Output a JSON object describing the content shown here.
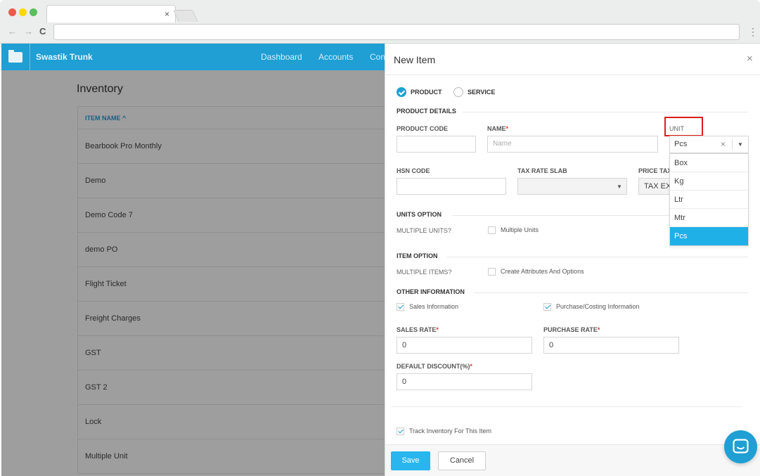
{
  "browser": {
    "tab_close_glyph": "×",
    "back_glyph": "←",
    "forward_glyph": "→",
    "reload_glyph": "C",
    "menu_glyph": "⋮"
  },
  "app": {
    "brand": "Swastik Trunk",
    "nav": [
      "Dashboard",
      "Accounts",
      "Con"
    ]
  },
  "inventory": {
    "title": "Inventory",
    "column_header": "ITEM NAME ^",
    "rows": [
      "Bearbook Pro Monthly",
      "Demo",
      "Demo Code 7",
      "demo PO",
      "Flight Ticket",
      "Freight Charges",
      "GST",
      "GST 2",
      "Lock",
      "Multiple Unit"
    ]
  },
  "panel": {
    "title": "New Item",
    "close_glyph": "×",
    "type_options": [
      {
        "label": "PRODUCT",
        "selected": true
      },
      {
        "label": "SERVICE",
        "selected": false
      }
    ],
    "product_details": {
      "heading": "PRODUCT DETAILS",
      "product_code_label": "PRODUCT CODE",
      "product_code_value": "",
      "name_label": "NAME",
      "name_required": "*",
      "name_placeholder": "Name",
      "unit_label": "UNIT",
      "unit_value": "Pcs",
      "unit_clear_glyph": "×",
      "unit_options": [
        "Box",
        "Kg",
        "Ltr",
        "Mtr",
        "Pcs"
      ],
      "unit_selected": "Pcs",
      "hsn_label": "HSN CODE",
      "hsn_value": "",
      "tax_slab_label": "TAX RATE SLAB",
      "tax_slab_value": "",
      "price_tax_label": "PRICE TAX",
      "price_tax_value": "TAX EX"
    },
    "units_option": {
      "heading": "UNITS OPTION",
      "label": "MULTIPLE UNITS?",
      "checkbox_label": "Multiple Units",
      "checked": false
    },
    "item_option": {
      "heading": "ITEM OPTION",
      "label": "MULTIPLE ITEMS?",
      "checkbox_label": "Create Attributes And Options",
      "checked": false
    },
    "other_information": {
      "heading": "OTHER INFORMATION",
      "sales_info_label": "Sales Information",
      "sales_info_checked": true,
      "purchase_info_label": "Purchase/Costing Information",
      "purchase_info_checked": true,
      "sales_rate_label": "SALES RATE",
      "sales_rate_required": "*",
      "sales_rate_value": "0",
      "purchase_rate_label": "PURCHASE RATE",
      "purchase_rate_required": "*",
      "purchase_rate_value": "0",
      "discount_label": "DEFAULT DISCOUNT(%)",
      "discount_required": "*",
      "discount_value": "0"
    },
    "track_inventory": {
      "label": "Track Inventory For This Item",
      "checked": true
    },
    "footer": {
      "save_label": "Save",
      "cancel_label": "Cancel"
    }
  },
  "colors": {
    "brand": "#1f9fd3",
    "selected_option": "#1fb0e8",
    "highlight": "#e01b1b",
    "required": "#e53935"
  }
}
